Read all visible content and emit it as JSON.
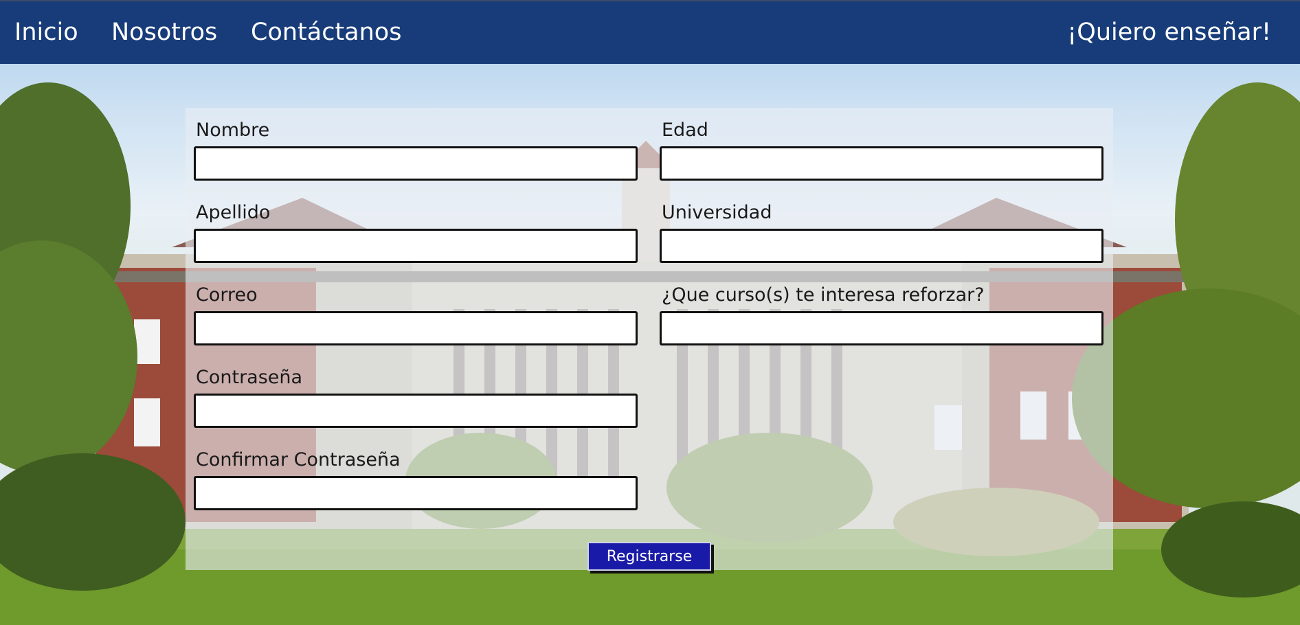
{
  "nav": {
    "home": "Inicio",
    "about": "Nosotros",
    "contact": "Contáctanos",
    "teach": "¡Quiero enseñar!"
  },
  "form": {
    "nombre_label": "Nombre",
    "apellido_label": "Apellido",
    "correo_label": "Correo",
    "contrasena_label": "Contraseña",
    "confirmar_label": "Confirmar Contraseña",
    "edad_label": "Edad",
    "universidad_label": "Universidad",
    "cursos_label": "¿Que curso(s) te interesa reforzar?",
    "submit_label": "Registrarse"
  },
  "colors": {
    "navbar": "#173c79",
    "button": "#1a1aa8"
  }
}
